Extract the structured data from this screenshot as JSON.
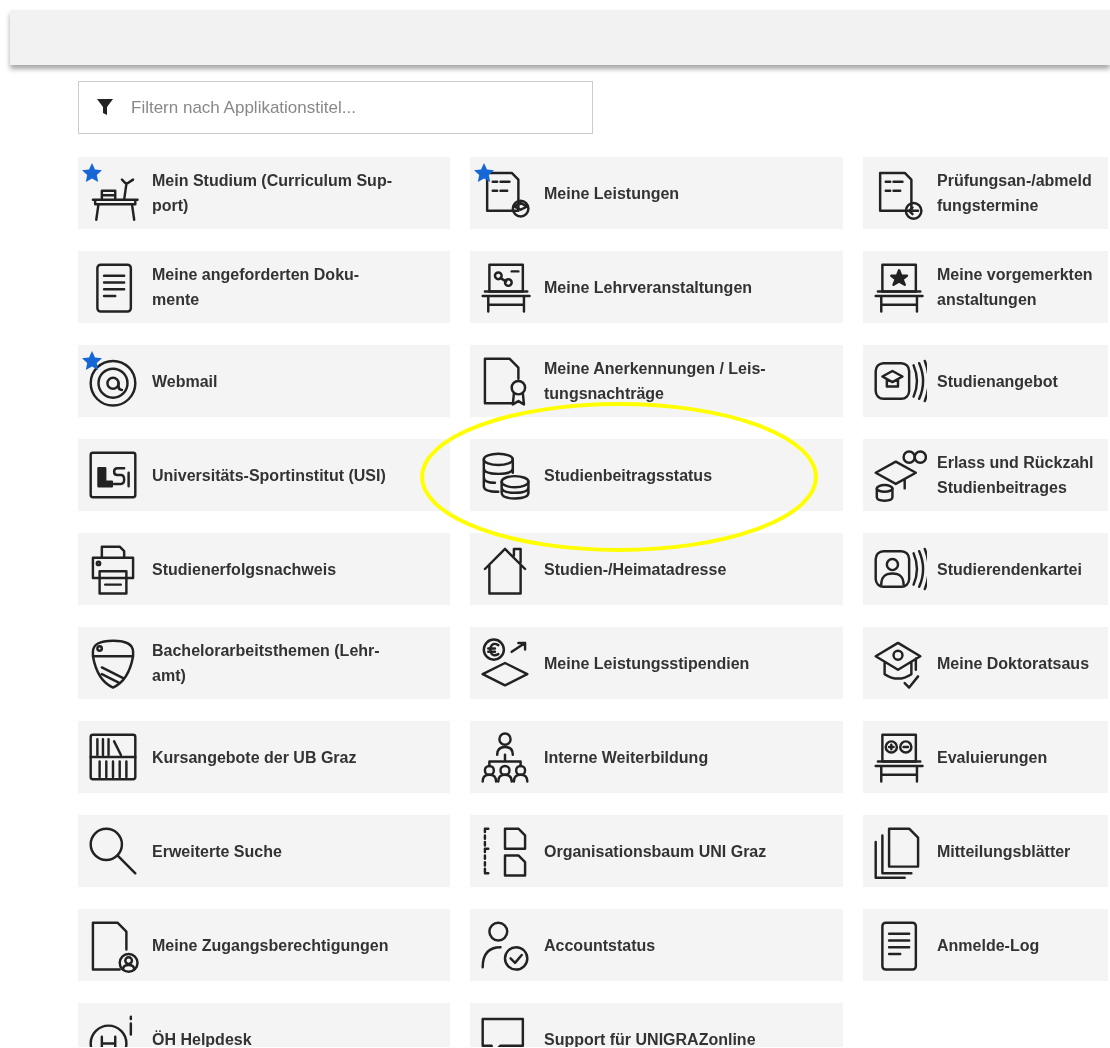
{
  "filter": {
    "placeholder": "Filtern nach Applikationstitel..."
  },
  "tiles": [
    {
      "label": "Mein Studium (Curriculum Sup-\nport)",
      "favorite": true,
      "highlighted": false
    },
    {
      "label": "Meine Leistungen",
      "favorite": true,
      "highlighted": false
    },
    {
      "label": "Prüfungsan-/abmeld\nfungstermine",
      "favorite": false,
      "highlighted": false
    },
    {
      "label": "Meine angeforderten Doku-\nmente",
      "favorite": false,
      "highlighted": false
    },
    {
      "label": "Meine Lehrveranstaltungen",
      "favorite": false,
      "highlighted": false
    },
    {
      "label": "Meine vorgemerkten\nanstaltungen",
      "favorite": false,
      "highlighted": false
    },
    {
      "label": "Webmail",
      "favorite": true,
      "highlighted": false
    },
    {
      "label": "Meine Anerkennungen / Leis-\ntungsnachträge",
      "favorite": false,
      "highlighted": false
    },
    {
      "label": "Studienangebot",
      "favorite": false,
      "highlighted": false
    },
    {
      "label": "Universitäts-Sportinstitut (USI)",
      "favorite": false,
      "highlighted": false
    },
    {
      "label": "Studienbeitragsstatus",
      "favorite": false,
      "highlighted": true
    },
    {
      "label": "Erlass und Rückzahl\nStudienbeitrages",
      "favorite": false,
      "highlighted": false
    },
    {
      "label": "Studienerfolgsnachweis",
      "favorite": false,
      "highlighted": false
    },
    {
      "label": "Studien-/Heimatadresse",
      "favorite": false,
      "highlighted": false
    },
    {
      "label": "Studierendenkartei",
      "favorite": false,
      "highlighted": false
    },
    {
      "label": "Bachelorarbeitsthemen (Lehr-\namt)",
      "favorite": false,
      "highlighted": false
    },
    {
      "label": "Meine Leistungsstipendien",
      "favorite": false,
      "highlighted": false
    },
    {
      "label": "Meine Doktoratsaus",
      "favorite": false,
      "highlighted": false
    },
    {
      "label": "Kursangebote der UB Graz",
      "favorite": false,
      "highlighted": false
    },
    {
      "label": "Interne Weiterbildung",
      "favorite": false,
      "highlighted": false
    },
    {
      "label": "Evaluierungen",
      "favorite": false,
      "highlighted": false
    },
    {
      "label": "Erweiterte Suche",
      "favorite": false,
      "highlighted": false
    },
    {
      "label": "Organisationsbaum UNI Graz",
      "favorite": false,
      "highlighted": false
    },
    {
      "label": "Mitteilungsblätter",
      "favorite": false,
      "highlighted": false
    },
    {
      "label": "Meine Zugangsberechtigungen",
      "favorite": false,
      "highlighted": false
    },
    {
      "label": "Accountstatus",
      "favorite": false,
      "highlighted": false
    },
    {
      "label": "Anmelde-Log",
      "favorite": false,
      "highlighted": false
    },
    {
      "label": "ÖH Helpdesk",
      "favorite": false,
      "highlighted": false
    },
    {
      "label": "Support für UNIGRAZonline",
      "favorite": false,
      "highlighted": false
    }
  ]
}
